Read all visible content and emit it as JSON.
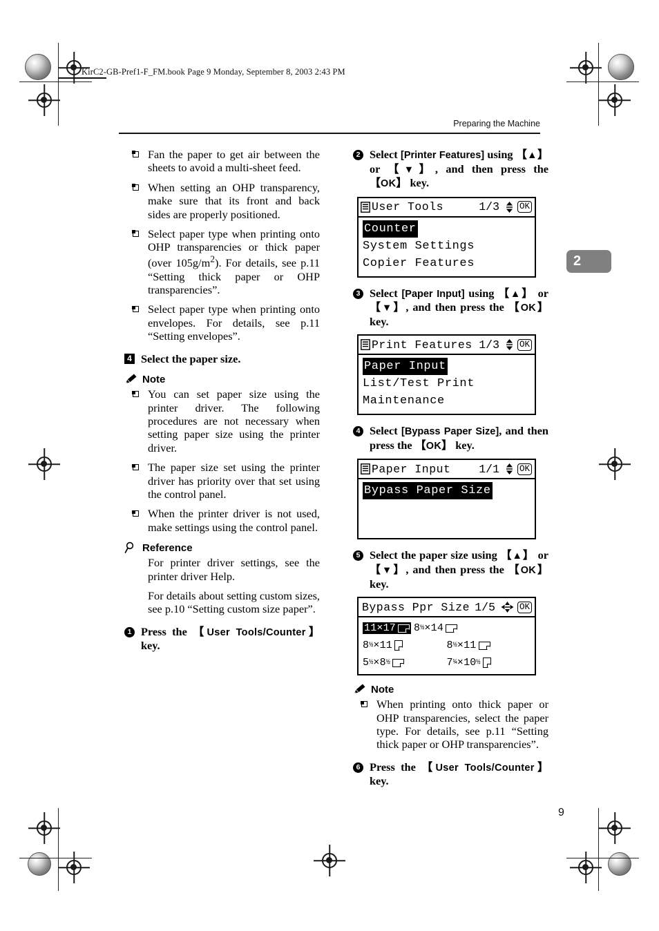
{
  "page": {
    "file_bar": "KirC2-GB-Pref1-F_FM.book  Page 9  Monday, September 8, 2003  2:43 PM",
    "running_head": "Preparing the Machine",
    "chapter_tab": "2",
    "page_number": "9"
  },
  "left_column": {
    "bullets_top": [
      "Fan the paper to get air between the sheets to avoid a multi-sheet feed.",
      "When setting an OHP transparency, make sure that its front and back sides are properly positioned.",
      "Select paper type when printing onto OHP transparencies or thick paper (over 105g/m2). For details, see p.11 “Setting thick paper or OHP transparencies”.",
      "Select paper type when printing onto envelopes. For details, see p.11 “Setting envelopes”."
    ],
    "step_4": {
      "number": "4",
      "text": "Select the paper size."
    },
    "note_label": "Note",
    "notes": [
      "You can set paper size using the printer driver. The following procedures are not necessary when setting paper size using the printer driver.",
      "The paper size set using the printer driver has priority over that set using the control panel.",
      "When the printer driver is not used, make settings using the control panel."
    ],
    "reference_label": "Reference",
    "reference_paragraphs": [
      "For printer driver settings, see the printer driver Help.",
      "For details about setting custom sizes, see p.10 “Setting custom size paper”."
    ],
    "step_1": {
      "number": "1",
      "before": "Press the ",
      "key": "User Tools/Counter",
      "after": " key."
    }
  },
  "right_column": {
    "step_2": {
      "number": "2",
      "part1": "Select ",
      "ui1": "[Printer Features]",
      "part2": " using ",
      "key_up": "▲",
      "part3": " or ",
      "key_down": "▼",
      "part4": ", and then press the ",
      "key_ok": "OK",
      "part5": " key."
    },
    "lcd_user_tools": {
      "title": "User Tools",
      "page_indicator": "1/3",
      "ok_label": "OK",
      "rows": [
        {
          "label": "Counter",
          "selected": true
        },
        {
          "label": "System Settings",
          "selected": false
        },
        {
          "label": "Copier Features",
          "selected": false
        }
      ]
    },
    "step_3": {
      "number": "3",
      "part1": "Select ",
      "ui1": "[Paper Input]",
      "part2": " using ",
      "key_up": "▲",
      "part3": " or ",
      "key_down": "▼",
      "part4": ", and then press the ",
      "key_ok": "OK",
      "part5": " key."
    },
    "lcd_print_features": {
      "title": "Print Features",
      "page_indicator": "1/3",
      "ok_label": "OK",
      "rows": [
        {
          "label": "Paper Input",
          "selected": true
        },
        {
          "label": "List/Test Print",
          "selected": false
        },
        {
          "label": "Maintenance",
          "selected": false
        }
      ]
    },
    "step_4": {
      "number": "4",
      "part1": "Select ",
      "ui1": "[Bypass Paper Size]",
      "part2": ", and then press the ",
      "key_ok": "OK",
      "part3": " key."
    },
    "lcd_paper_input": {
      "title": "Paper Input",
      "page_indicator": "1/1",
      "ok_label": "OK",
      "rows": [
        {
          "label": "Bypass Paper Size",
          "selected": true
        }
      ]
    },
    "step_5": {
      "number": "5",
      "part1": "Select the paper size using ",
      "key_up": "▲",
      "part2": " or ",
      "key_down": "▼",
      "part3": ", and then press the ",
      "key_ok": "OK",
      "part4": " key."
    },
    "lcd_bypass_size": {
      "title": "Bypass Ppr Size",
      "page_indicator": "1/5",
      "ok_label": "OK",
      "sizes": [
        {
          "whole1": "11",
          "frac1": "",
          "whole2": "17",
          "frac2": "",
          "orient": "landscape",
          "selected": true
        },
        {
          "whole1": "8",
          "frac1": "½",
          "whole2": "14",
          "frac2": "",
          "orient": "landscape",
          "selected": false
        },
        {
          "whole1": "8",
          "frac1": "½",
          "whole2": "11",
          "frac2": "",
          "orient": "portrait",
          "selected": false
        },
        {
          "whole1": "8",
          "frac1": "½",
          "whole2": "11",
          "frac2": "",
          "orient": "landscape",
          "selected": false
        },
        {
          "whole1": "5",
          "frac1": "½",
          "whole2": "8",
          "frac2": "½",
          "orient": "landscape",
          "selected": false
        },
        {
          "whole1": "7",
          "frac1": "¼",
          "whole2": "10",
          "frac2": "½",
          "orient": "portrait",
          "selected": false
        }
      ]
    },
    "note_label": "Note",
    "notes": [
      "When printing onto thick paper or OHP transparencies, select the paper type. For details, see p.11 “Setting thick paper or OHP transparencies”."
    ],
    "step_6": {
      "number": "6",
      "before": "Press the ",
      "key": "User Tools/Counter",
      "after": " key."
    }
  }
}
